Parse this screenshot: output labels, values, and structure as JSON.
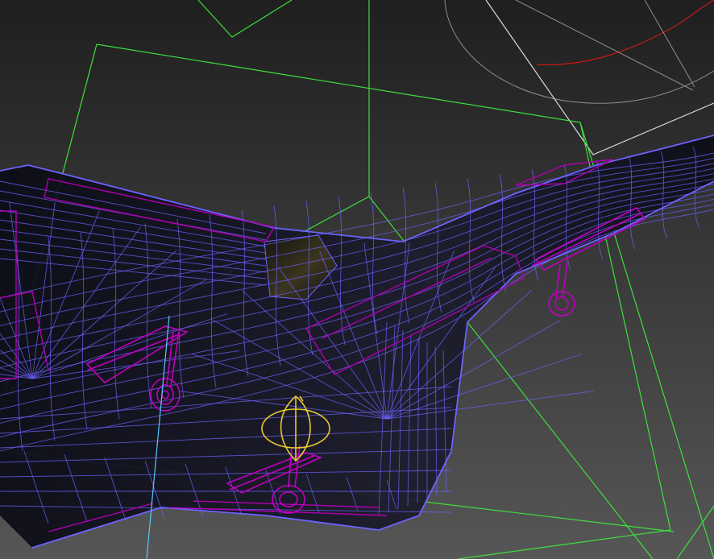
{
  "viewport": {
    "background_top": "#1f1f1f",
    "background_bottom": "#565656",
    "colors": {
      "mesh_wire": "#6c63ff",
      "selected_wire": "#b000b0",
      "frustum": "#3de03d",
      "gizmo": "#e8c830",
      "axis_line": "#57c8ff",
      "helper_white": "#dcdcdc",
      "helper_red": "#c81818",
      "helper_gray": "#8e8e8e",
      "hull_fill": "#0c0c1a",
      "canopy_glass": "#24241f"
    },
    "objects": [
      {
        "name": "aircraft-body",
        "icon": "mesh-wireframe"
      },
      {
        "name": "main-landing-gear-left",
        "icon": "gear-strut"
      },
      {
        "name": "main-landing-gear-right",
        "icon": "gear-strut"
      },
      {
        "name": "nose-landing-gear",
        "icon": "gear-strut"
      },
      {
        "name": "camera-frustum",
        "icon": "camera-frustum"
      },
      {
        "name": "transform-gizmo",
        "icon": "rotate-gizmo"
      }
    ]
  }
}
